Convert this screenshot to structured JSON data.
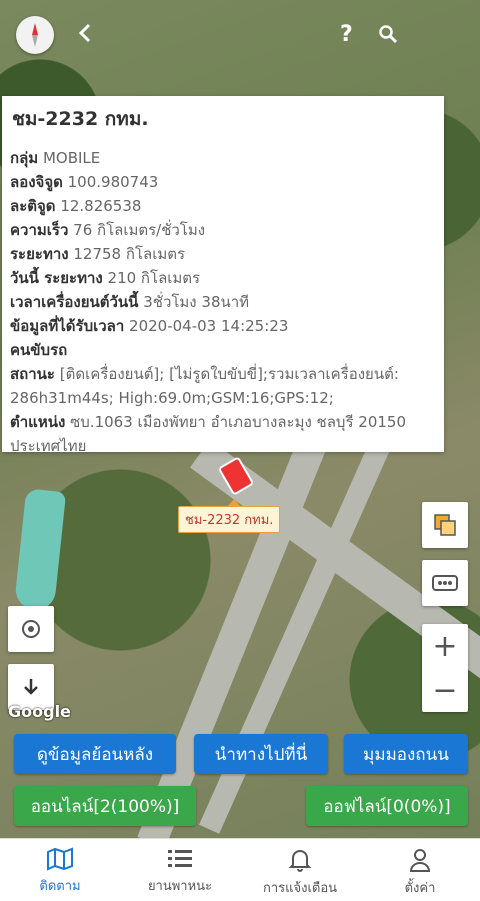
{
  "map": {
    "watermark": "Google",
    "marker_label": "ชม-2232 กทม."
  },
  "header": {
    "back_icon": "chevron-left-icon",
    "help_icon": "question-icon",
    "search_icon": "search-icon",
    "compass_icon": "compass-icon"
  },
  "info": {
    "title": "ชม-2232 กทม.",
    "rows": [
      {
        "label": "กลุ่ม",
        "value": "MOBILE"
      },
      {
        "label": "ลองจิจูด",
        "value": "100.980743"
      },
      {
        "label": "ละติจูด",
        "value": "12.826538"
      },
      {
        "label": "ความเร็ว",
        "value": "76 กิโลเมตร/ชั่วโมง"
      },
      {
        "label": "ระยะทาง",
        "value": "12758 กิโลเมตร"
      },
      {
        "label": "วันนี้ ระยะทาง",
        "value": "210 กิโลเมตร"
      },
      {
        "label": "เวลาเครื่องยนต์วันนี้",
        "value": "3ชั่วโมง 38นาที"
      },
      {
        "label": "ข้อมูลที่ได้รับเวลา",
        "value": "2020-04-03 14:25:23"
      },
      {
        "label": "คนขับรถ",
        "value": ""
      },
      {
        "label": "สถานะ",
        "value": "[ติดเครื่องยนต์]; [ไม่รูดใบขับขี่];รวมเวลาเครื่องยนต์: 286h31m44s; High:69.0m;GSM:16;GPS:12;"
      },
      {
        "label": "ตำแหน่ง",
        "value": "ซบ.1063 เมืองพัทยา อำเภอบางละมุง ชลบุรี 20150 ประเทศไทย"
      }
    ]
  },
  "actions": {
    "history": "ดูข้อมูลย้อนหลัง",
    "navigate": "นำทางไปที่นี่",
    "street_view": "มุมมองถนน",
    "online": "ออนไลน์[2(100%)]",
    "offline": "ออฟไลน์[0(0%)]"
  },
  "tabs": [
    {
      "label": "ติดตาม",
      "icon": "map-icon",
      "active": true
    },
    {
      "label": "ยานพาหนะ",
      "icon": "list-icon",
      "active": false
    },
    {
      "label": "การแจ้งเตือน",
      "icon": "bell-icon",
      "active": false
    },
    {
      "label": "ตั้งค่า",
      "icon": "user-icon",
      "active": false
    }
  ],
  "colors": {
    "primary": "#1a78d4",
    "success": "#3aa84a"
  }
}
